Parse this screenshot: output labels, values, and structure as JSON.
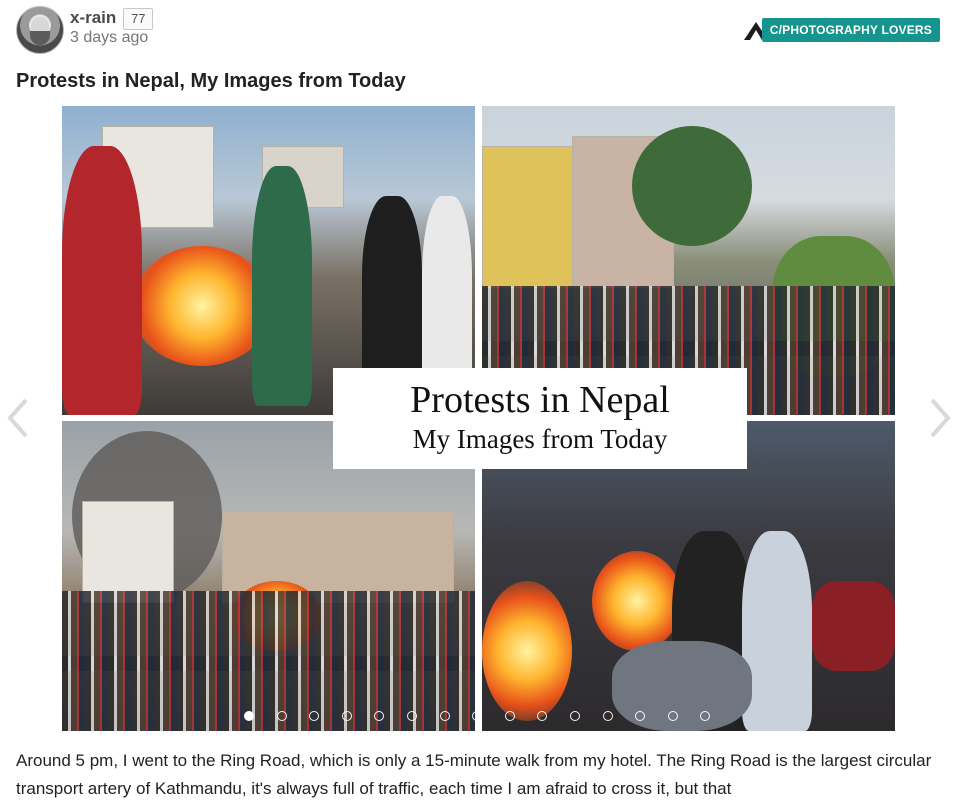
{
  "post": {
    "username": "x-rain",
    "karma": "77",
    "time": "3 days ago",
    "community": "C/PHOTOGRAPHY LOVERS",
    "title": "Protests in Nepal, My Images from Today",
    "body": "Around 5 pm, I went to the Ring Road, which is only a 15-minute walk from my hotel. The Ring Road is the largest circular transport artery of Kathmandu, it's always full of traffic, each time I am afraid to cross it, but that"
  },
  "gallery": {
    "card_title": "Protests in Nepal",
    "card_subtitle": "My Images from Today",
    "slide_count": 15,
    "active_slide": 1
  },
  "icons": {
    "community_logo": "triangle-logo-icon",
    "prev": "chevron-left-icon",
    "next": "chevron-right-icon"
  },
  "colors": {
    "badge": "#16958f",
    "title": "#222222",
    "meta": "#757575"
  }
}
